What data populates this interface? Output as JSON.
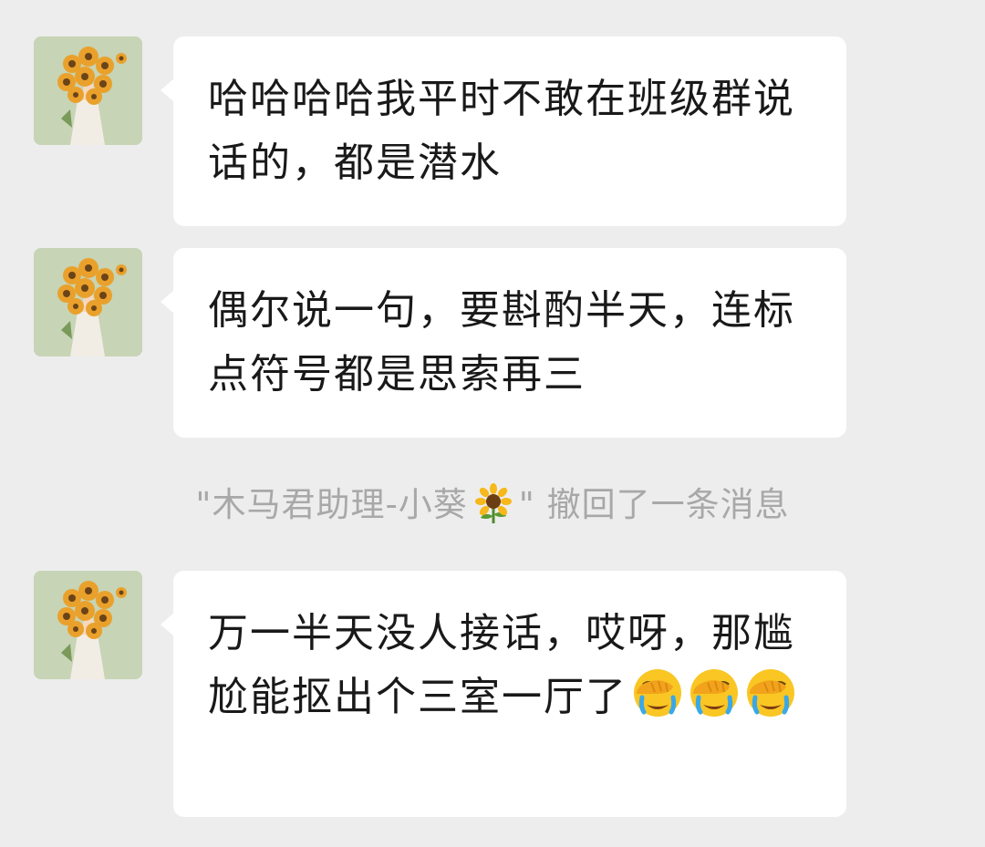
{
  "messages": [
    {
      "sender_avatar": "sunflower-girl-avatar",
      "text": "哈哈哈哈我平时不敢在班级群说话的，都是潜水"
    },
    {
      "sender_avatar": "sunflower-girl-avatar",
      "text": "偶尔说一句，要斟酌半天，连标点符号都是思索再三"
    },
    {
      "sender_avatar": "sunflower-girl-avatar",
      "text": "万一半天没人接话，哎呀，那尴尬能抠出个三室一厅了",
      "emoji": [
        "face-with-hand-over-eyes-laughing",
        "face-with-hand-over-eyes-laughing",
        "face-with-hand-over-eyes-laughing"
      ]
    }
  ],
  "system_notice": {
    "prefix": "\"木马君助理-小葵",
    "emoji": "sunflower",
    "suffix": "\" 撤回了一条消息"
  },
  "colors": {
    "background": "#ededed",
    "bubble": "#ffffff",
    "text": "#191919",
    "notice_text": "#a8a8a8"
  }
}
